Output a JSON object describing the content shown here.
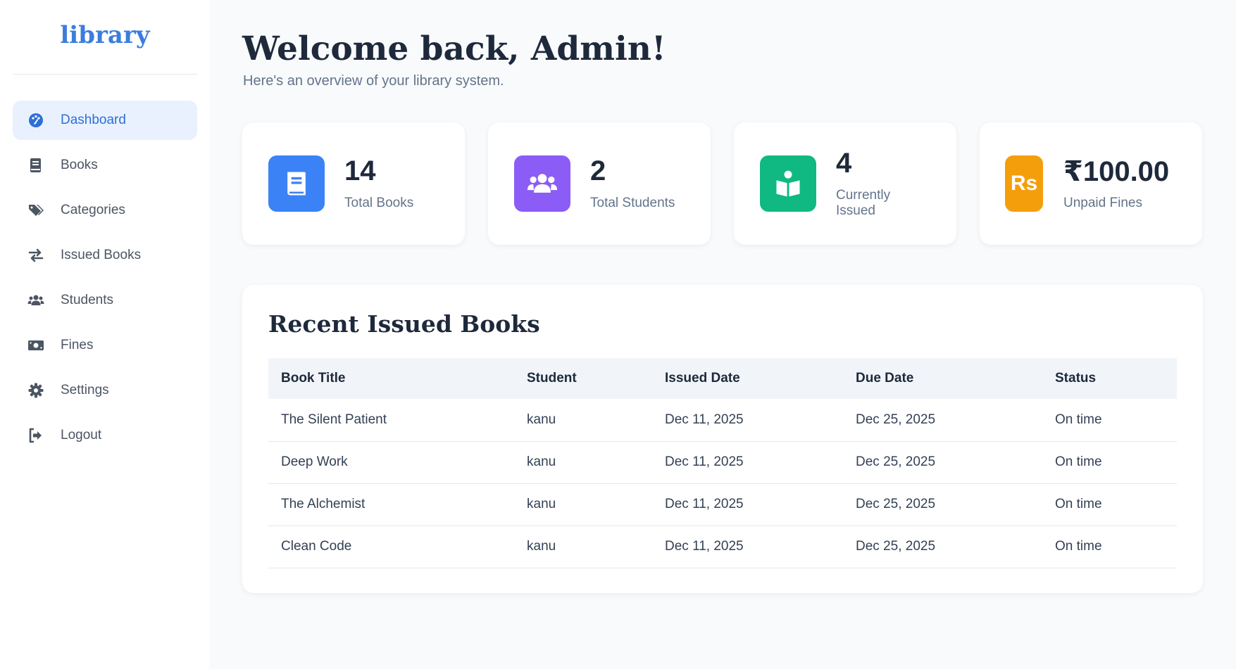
{
  "sidebar": {
    "logo": "library",
    "items": [
      {
        "label": "Dashboard",
        "icon": "palette-icon",
        "active": true
      },
      {
        "label": "Books",
        "icon": "book-icon"
      },
      {
        "label": "Categories",
        "icon": "tags-icon"
      },
      {
        "label": "Issued Books",
        "icon": "exchange-icon"
      },
      {
        "label": "Students",
        "icon": "users-icon"
      },
      {
        "label": "Fines",
        "icon": "money-icon"
      },
      {
        "label": "Settings",
        "icon": "gear-icon"
      },
      {
        "label": "Logout",
        "icon": "logout-icon"
      }
    ]
  },
  "header": {
    "title": "Welcome back, Admin!",
    "subtitle": "Here's an overview of your library system."
  },
  "stats": [
    {
      "value": "14",
      "label": "Total Books",
      "icon": "book-icon",
      "color": "#3b82f6"
    },
    {
      "value": "2",
      "label": "Total Students",
      "icon": "users-icon",
      "color": "#8b5cf6"
    },
    {
      "value": "4",
      "label": "Currently Issued",
      "icon": "reader-icon",
      "color": "#10b981"
    },
    {
      "value": "₹100.00",
      "label": "Unpaid Fines",
      "icon": "rupee-icon",
      "color": "#f59e0b",
      "icon_text": "Rs"
    }
  ],
  "recent": {
    "title": "Recent Issued Books",
    "columns": [
      "Book Title",
      "Student",
      "Issued Date",
      "Due Date",
      "Status"
    ],
    "rows": [
      [
        "The Silent Patient",
        "kanu",
        "Dec 11, 2025",
        "Dec 25, 2025",
        "On time"
      ],
      [
        "Deep Work",
        "kanu",
        "Dec 11, 2025",
        "Dec 25, 2025",
        "On time"
      ],
      [
        "The Alchemist",
        "kanu",
        "Dec 11, 2025",
        "Dec 25, 2025",
        "On time"
      ],
      [
        "Clean Code",
        "kanu",
        "Dec 11, 2025",
        "Dec 25, 2025",
        "On time"
      ]
    ]
  }
}
